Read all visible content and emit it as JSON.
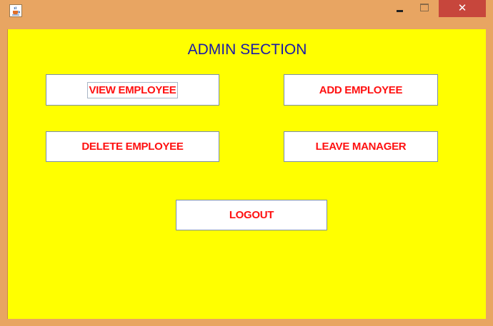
{
  "window": {
    "app_icon": "java-coffee-cup-icon",
    "minimize_icon": "minimize-icon",
    "maximize_icon": "maximize-icon",
    "close_glyph": "✕",
    "frame_color": "#e8a562",
    "close_color": "#c7463c"
  },
  "panel": {
    "background": "#ffff00",
    "title": "ADMIN SECTION",
    "title_color": "#1a1aa8"
  },
  "buttons": {
    "label_color": "#ff1010",
    "view_employee": "VIEW EMPLOYEE",
    "add_employee": "ADD EMPLOYEE",
    "delete_employee": "DELETE EMPLOYEE",
    "leave_manager": "LEAVE MANAGER",
    "logout": "LOGOUT"
  }
}
